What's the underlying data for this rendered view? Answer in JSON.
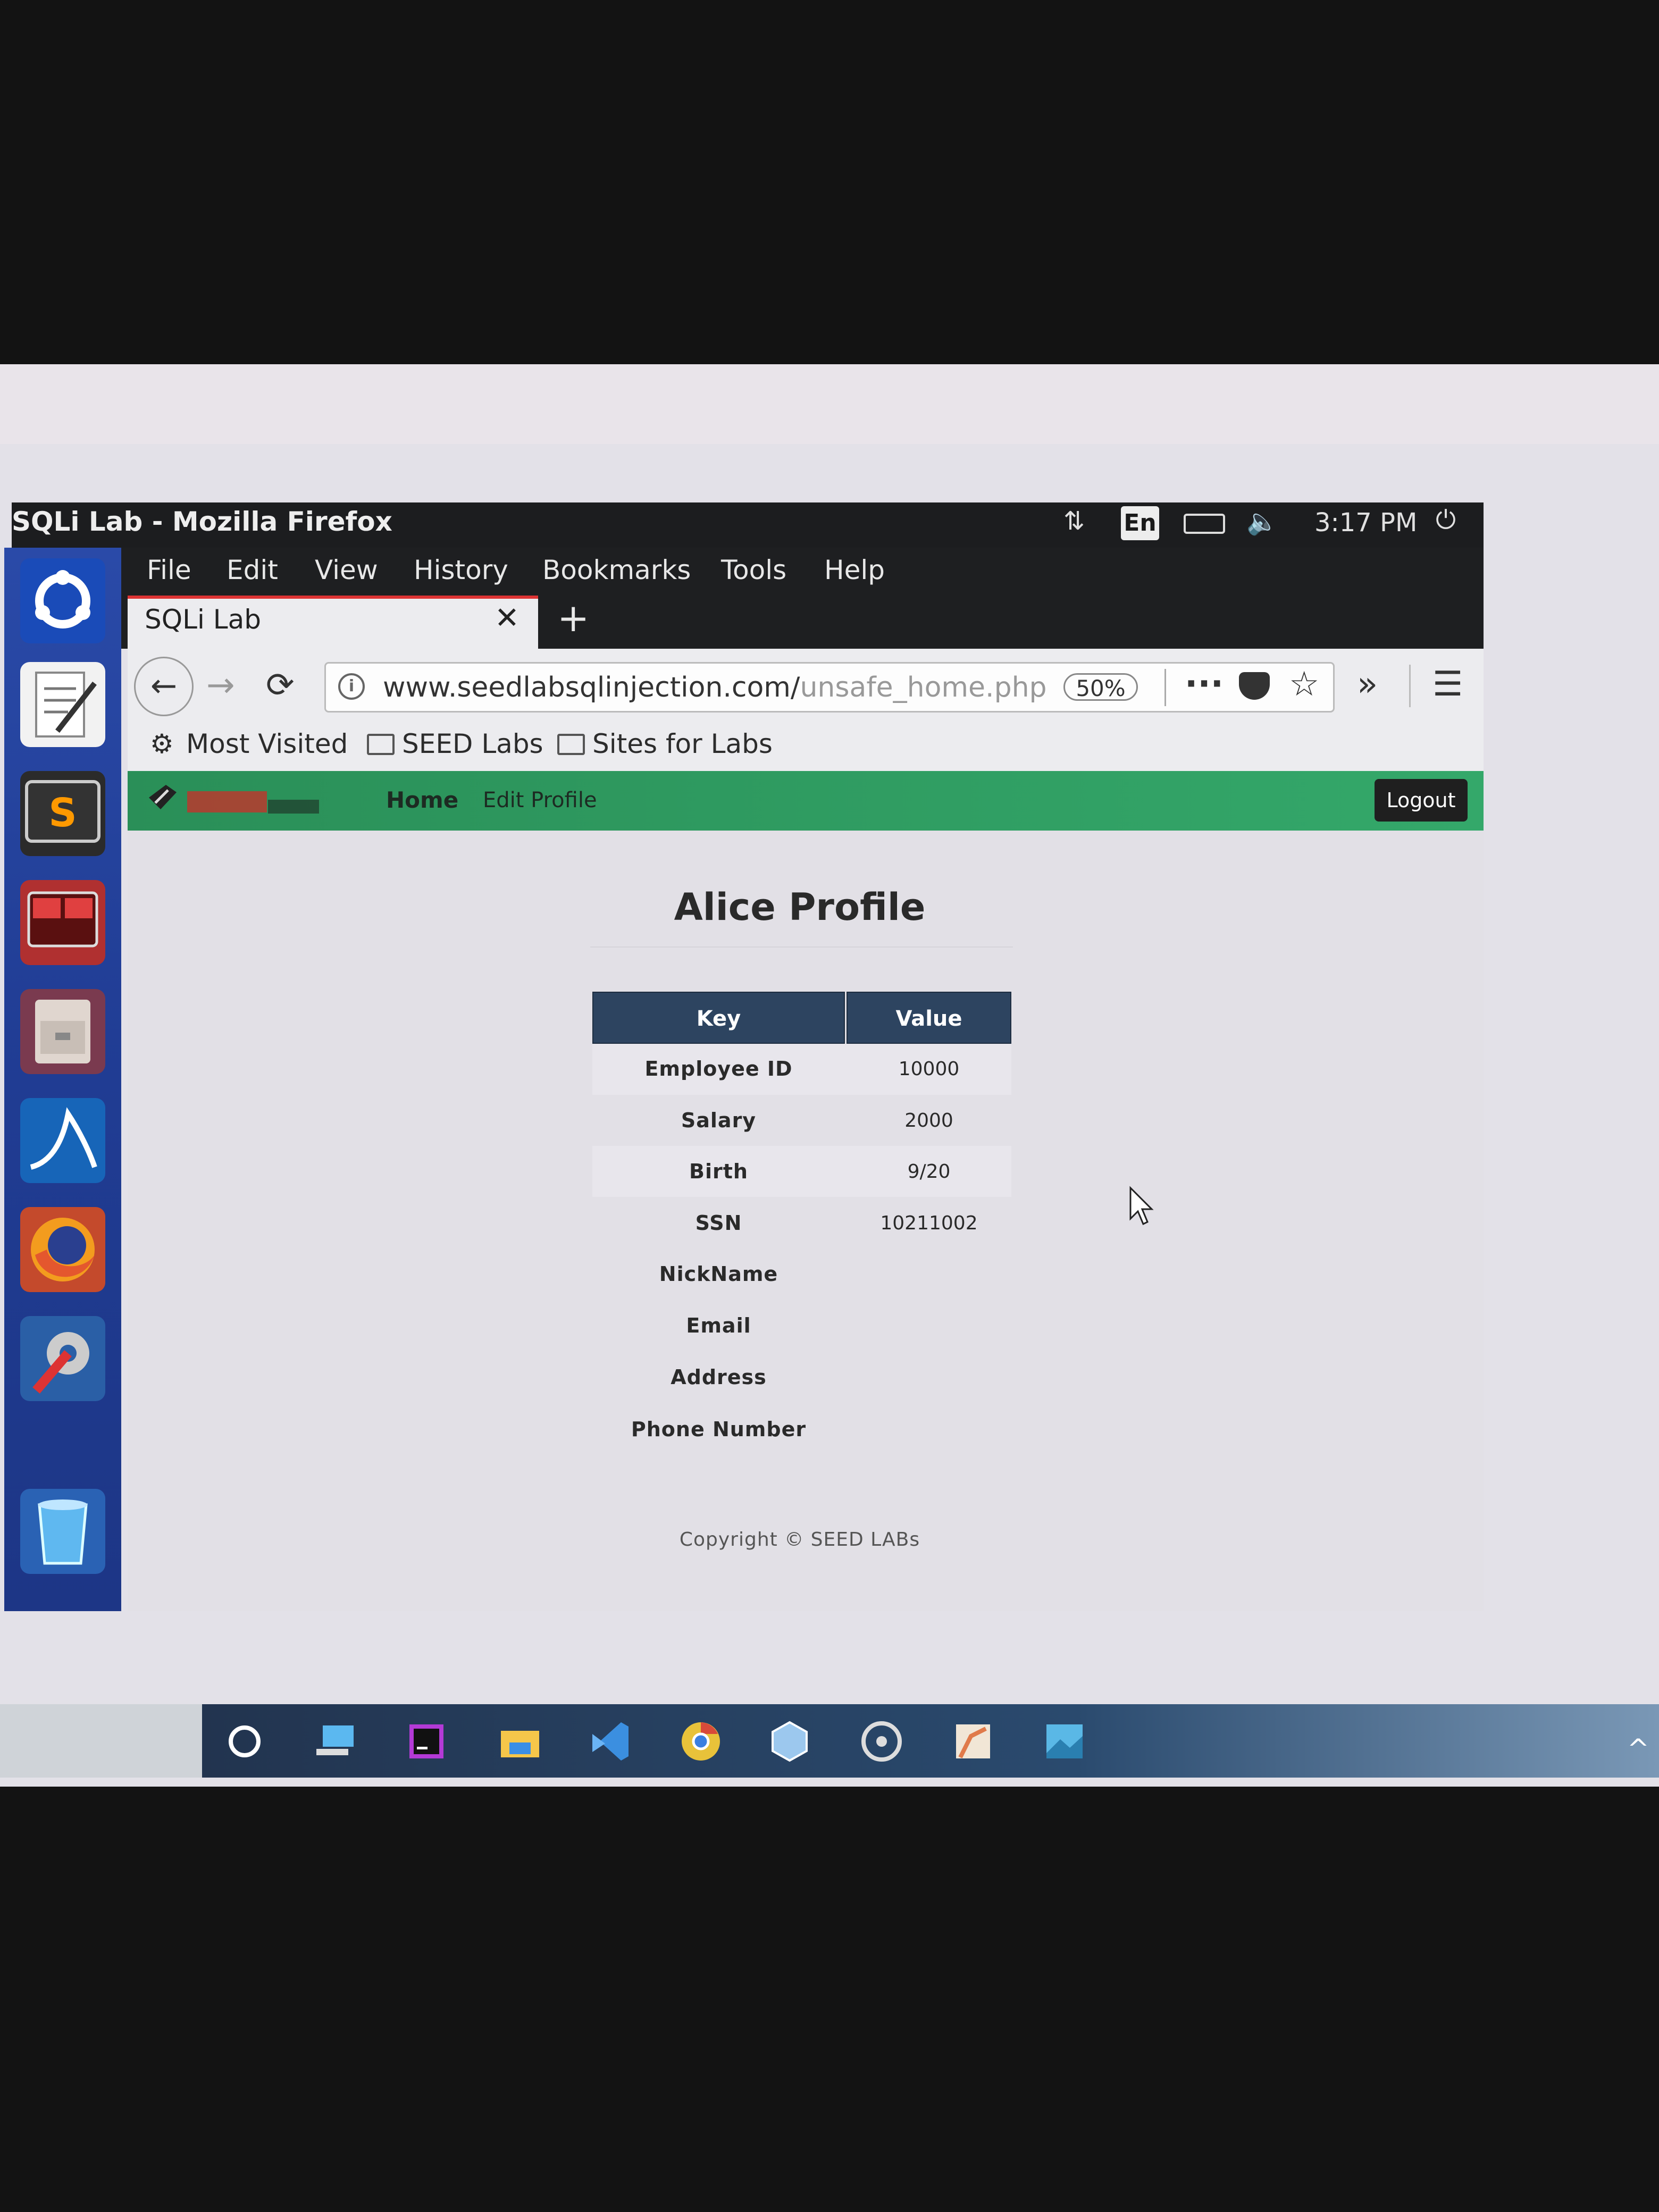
{
  "window": {
    "title": "SQLi Lab - Mozilla Firefox"
  },
  "tray": {
    "lang": "En",
    "time": "3:17 PM"
  },
  "menu": [
    "File",
    "Edit",
    "View",
    "History",
    "Bookmarks",
    "Tools",
    "Help"
  ],
  "tab": {
    "title": "SQLi Lab"
  },
  "url": {
    "main": "www.seedlabsqlinjection.com/",
    "path": "unsafe_home.php",
    "zoom": "50%"
  },
  "bookmarks": [
    "Most Visited",
    "SEED Labs",
    "Sites for Labs"
  ],
  "site": {
    "nav": {
      "home": "Home",
      "edit": "Edit Profile",
      "logout": "Logout"
    },
    "title": "Alice Profile",
    "table": {
      "headers": [
        "Key",
        "Value"
      ],
      "rows": [
        {
          "key": "Employee ID",
          "value": "10000"
        },
        {
          "key": "Salary",
          "value": "2000"
        },
        {
          "key": "Birth",
          "value": "9/20"
        },
        {
          "key": "SSN",
          "value": "10211002"
        },
        {
          "key": "NickName",
          "value": ""
        },
        {
          "key": "Email",
          "value": ""
        },
        {
          "key": "Address",
          "value": ""
        },
        {
          "key": "Phone Number",
          "value": ""
        }
      ]
    },
    "footer": "Copyright © SEED LABs"
  },
  "colors": {
    "header": "#2d4460",
    "navbar": "#2d9a5f",
    "launcher": "#203c93"
  },
  "icons": {
    "launcher": [
      "ubuntu-icon",
      "text-editor-icon",
      "sublime-icon",
      "terminal-icon",
      "files-icon",
      "wireshark-icon",
      "firefox-icon",
      "settings-icon",
      "trash-icon"
    ],
    "taskbar": [
      "cortana-icon",
      "pc-icon",
      "jetbrains-icon",
      "file-explorer-icon",
      "vscode-icon",
      "chrome-icon",
      "virtualbox-icon",
      "media-icon",
      "maps-icon",
      "photos-icon"
    ]
  }
}
